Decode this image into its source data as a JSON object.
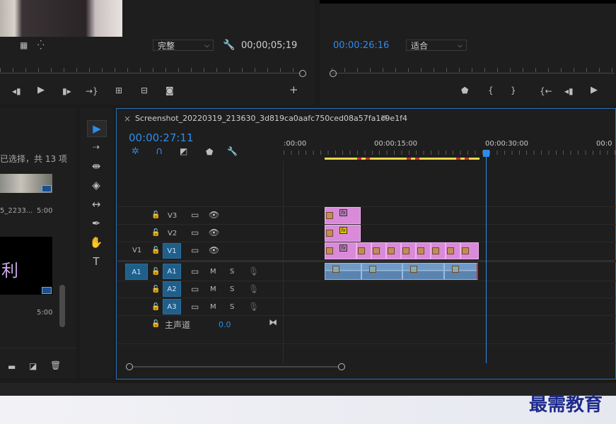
{
  "source_monitor": {
    "timecode": "00;00;05;19",
    "quality": "完整"
  },
  "program_monitor": {
    "timecode": "00:00:26:16",
    "fit": "适合"
  },
  "project_panel": {
    "selected_count": "已选择，共 13 项",
    "items": [
      {
        "name": "5_2233...",
        "duration": "5:00"
      },
      {
        "name": "",
        "duration": "5:00"
      }
    ],
    "preview_text": "利"
  },
  "timeline": {
    "tab_close": "×",
    "sequence_name": "Screenshot_20220319_213630_3d819ca0aafc750ced08a57fa1c9e1f4",
    "menu": "≡",
    "playhead_timecode": "00:00:27:11",
    "ruler_labels": [
      ":00:00",
      "00:00:15:00",
      "00:00:30:00",
      "00:0"
    ],
    "tracks": {
      "v3": "V3",
      "v2": "V2",
      "v1": "V1",
      "v1_source": "V1",
      "a1": "A1",
      "a2": "A2",
      "a3": "A3",
      "a1_source": "A1",
      "mute": "M",
      "solo": "S",
      "master_label": "主声道",
      "master_value": "0.0"
    },
    "clip_fx": "fx"
  },
  "watermark": "最需教育",
  "colors": {
    "accent_blue": "#2d8ceb",
    "video_clip": "#d98ad9",
    "audio_clip": "#6f9ac8",
    "track_target": "#1f5f8a"
  }
}
